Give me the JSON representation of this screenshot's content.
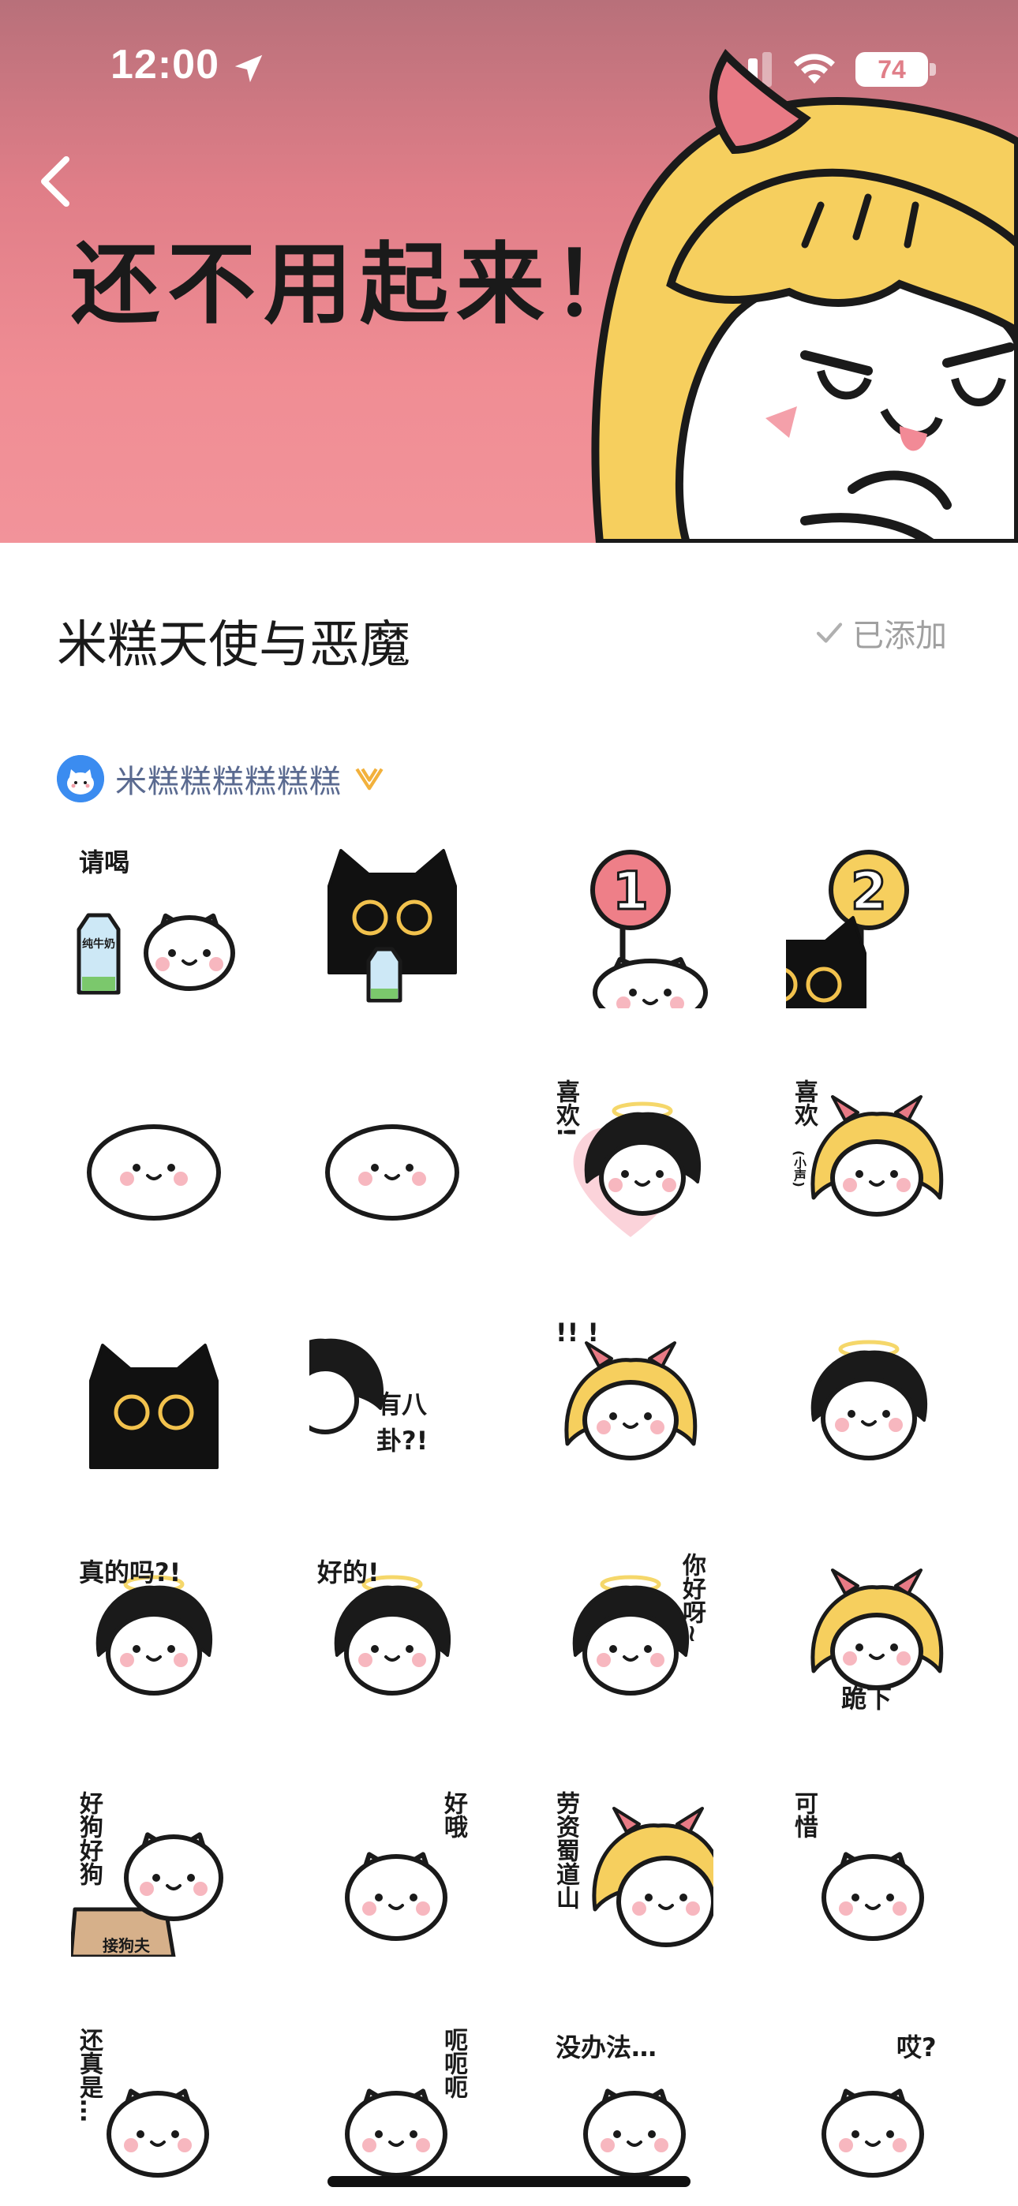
{
  "status_bar": {
    "time": "12:00",
    "battery": "74"
  },
  "banner": {
    "title": "还不用起来！"
  },
  "pack": {
    "title": "米糕天使与恶魔",
    "added_label": "已添加"
  },
  "author": {
    "name": "米糕糕糕糕糕糕"
  },
  "stickers": [
    {
      "label": "请喝",
      "sub": "纯牛奶"
    },
    {
      "label": "",
      "sub": ""
    },
    {
      "label": "1",
      "sub": ""
    },
    {
      "label": "2",
      "sub": ""
    },
    {
      "label": "",
      "sub": ""
    },
    {
      "label": "",
      "sub": ""
    },
    {
      "label": "喜欢!",
      "sub": ""
    },
    {
      "label": "喜欢",
      "sub": "(小声)"
    },
    {
      "label": "",
      "sub": ""
    },
    {
      "label": "有八卦?!",
      "sub": ""
    },
    {
      "label": "!! !",
      "sub": ""
    },
    {
      "label": "",
      "sub": ""
    },
    {
      "label": "真的吗?!",
      "sub": ""
    },
    {
      "label": "好的!",
      "sub": ""
    },
    {
      "label": "你好呀~",
      "sub": ""
    },
    {
      "label": "跪下",
      "sub": ""
    },
    {
      "label": "好狗好狗",
      "sub": "接狗夫"
    },
    {
      "label": "好哦",
      "sub": ""
    },
    {
      "label": "劳资蜀道山",
      "sub": ""
    },
    {
      "label": "可惜",
      "sub": ""
    },
    {
      "label": "还真是…",
      "sub": ""
    },
    {
      "label": "呃呃呃",
      "sub": ""
    },
    {
      "label": "没办法…",
      "sub": ""
    },
    {
      "label": "哎?",
      "sub": ""
    }
  ],
  "colors": {
    "banner_pink": "#f08d94",
    "halo_yellow": "#f5d76a",
    "devil_pink": "#e87a85",
    "hair_yellow": "#f6cf5e",
    "author_blue": "#5a6a90",
    "added_gray": "#a0a0a0"
  }
}
